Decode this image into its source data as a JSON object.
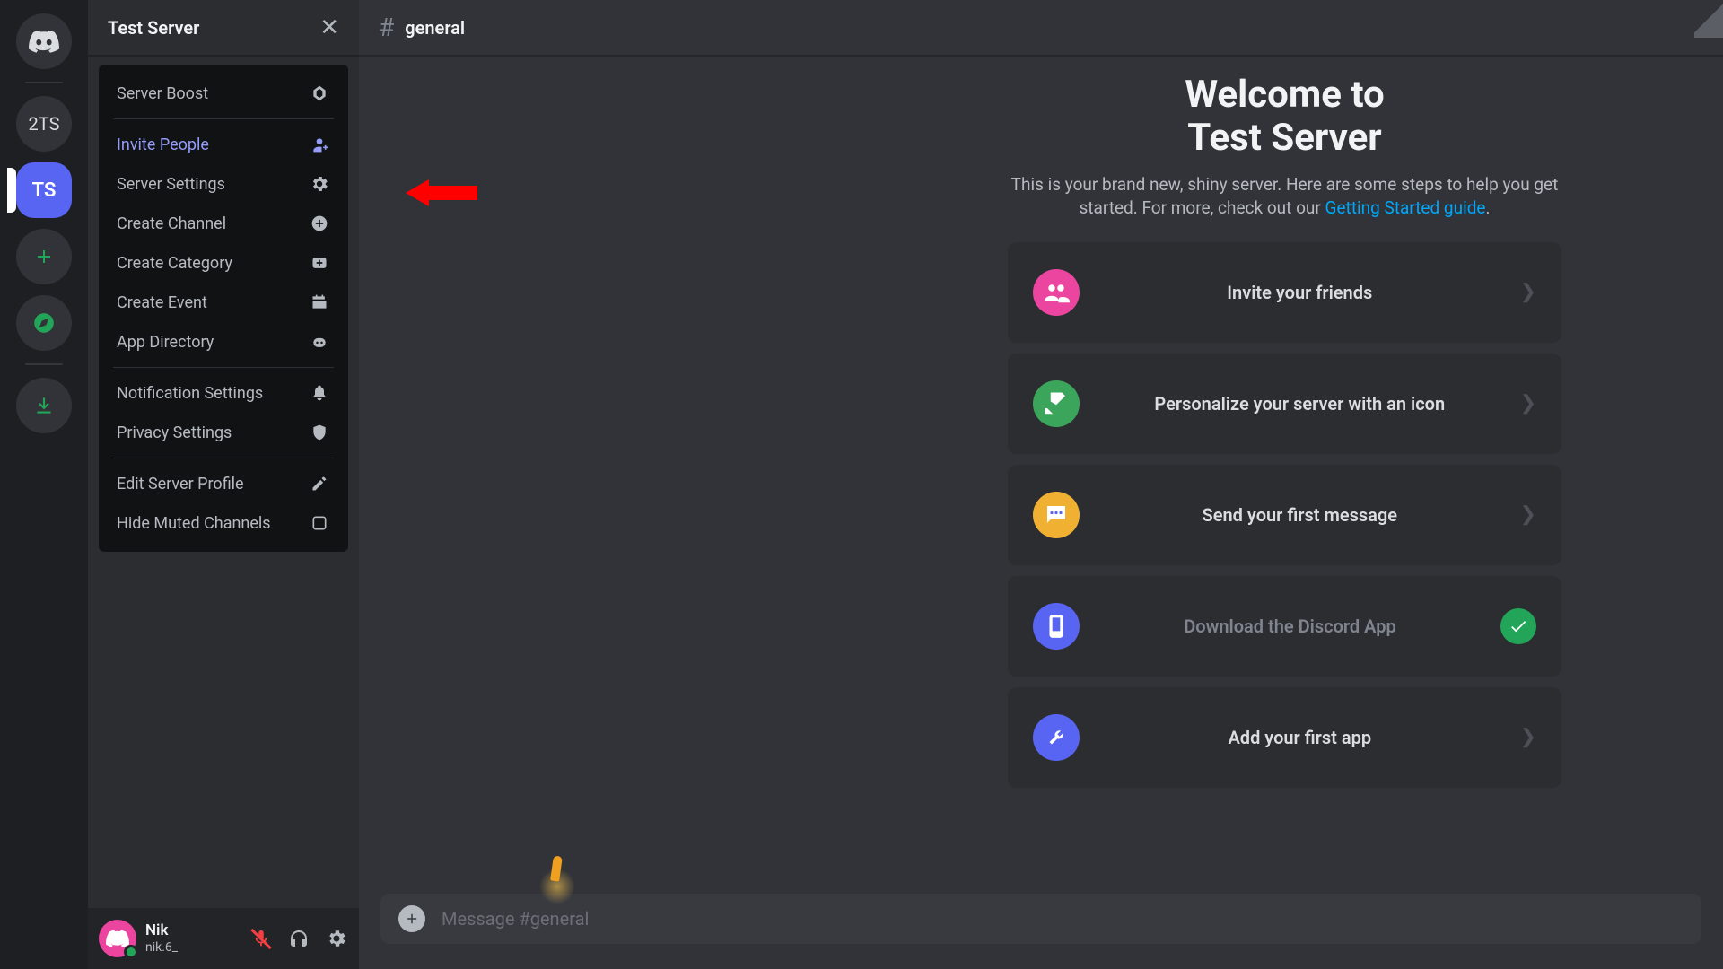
{
  "rail": {
    "items": [
      {
        "name": "discord-home",
        "label": ""
      },
      {
        "name": "server-2ts",
        "label": "2TS"
      },
      {
        "name": "server-ts",
        "label": "TS"
      }
    ]
  },
  "server": {
    "title": "Test Server"
  },
  "dropdown": {
    "boost": "Server Boost",
    "invite": "Invite People",
    "settings": "Server Settings",
    "create_channel": "Create Channel",
    "create_category": "Create Category",
    "create_event": "Create Event",
    "app_directory": "App Directory",
    "notification": "Notification Settings",
    "privacy": "Privacy Settings",
    "edit_profile": "Edit Server Profile",
    "hide_muted": "Hide Muted Channels"
  },
  "user": {
    "name": "Nik",
    "tag": "nik.6_"
  },
  "channel": {
    "name": "general"
  },
  "welcome": {
    "title_line1": "Welcome to",
    "title_line2": "Test Server",
    "sub_pre": "This is your brand new, shiny server. Here are some steps to help you get started. For more, check out our ",
    "sub_link": "Getting Started guide",
    "sub_post": "."
  },
  "cards": [
    {
      "label": "Invite your friends",
      "icon_bg": "#eb459f",
      "done": false
    },
    {
      "label": "Personalize your server with an icon",
      "icon_bg": "#23a55a",
      "done": false
    },
    {
      "label": "Send your first message",
      "icon_bg": "#f0b132",
      "done": false
    },
    {
      "label": "Download the Discord App",
      "icon_bg": "#5865f2",
      "done": true
    },
    {
      "label": "Add your first app",
      "icon_bg": "#5865f2",
      "done": false
    }
  ],
  "composer": {
    "placeholder": "Message #general"
  }
}
